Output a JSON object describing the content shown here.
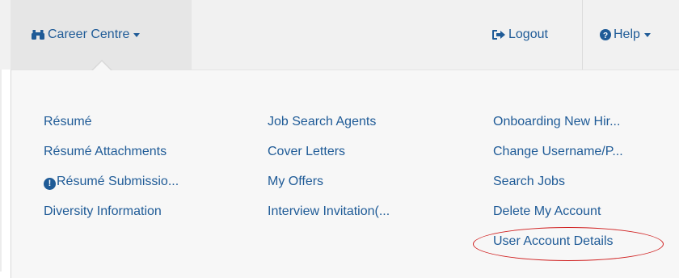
{
  "nav": {
    "career_centre": {
      "label": "Career Centre",
      "icon": "binoculars-icon"
    },
    "logout": {
      "label": "Logout",
      "icon": "sign-out-icon"
    },
    "help": {
      "label": "Help",
      "icon": "question-circle-icon"
    }
  },
  "menu": {
    "columns": [
      [
        "Résumé",
        "Résumé Attachments",
        "Résumé Submissio...",
        "Diversity Information"
      ],
      [
        "Job Search Agents",
        "Cover Letters",
        "My Offers",
        "Interview Invitation(..."
      ],
      [
        "Onboarding New Hir...",
        "Change Username/P...",
        "Search Jobs",
        "Delete My Account",
        "User Account Details"
      ]
    ],
    "warning_icon": "exclamation-circle-icon"
  },
  "colors": {
    "link": "#1f5b97",
    "highlight_ring": "#d02020",
    "topbar": "#f1f1f1",
    "menu_bg": "#f7f7f7"
  }
}
